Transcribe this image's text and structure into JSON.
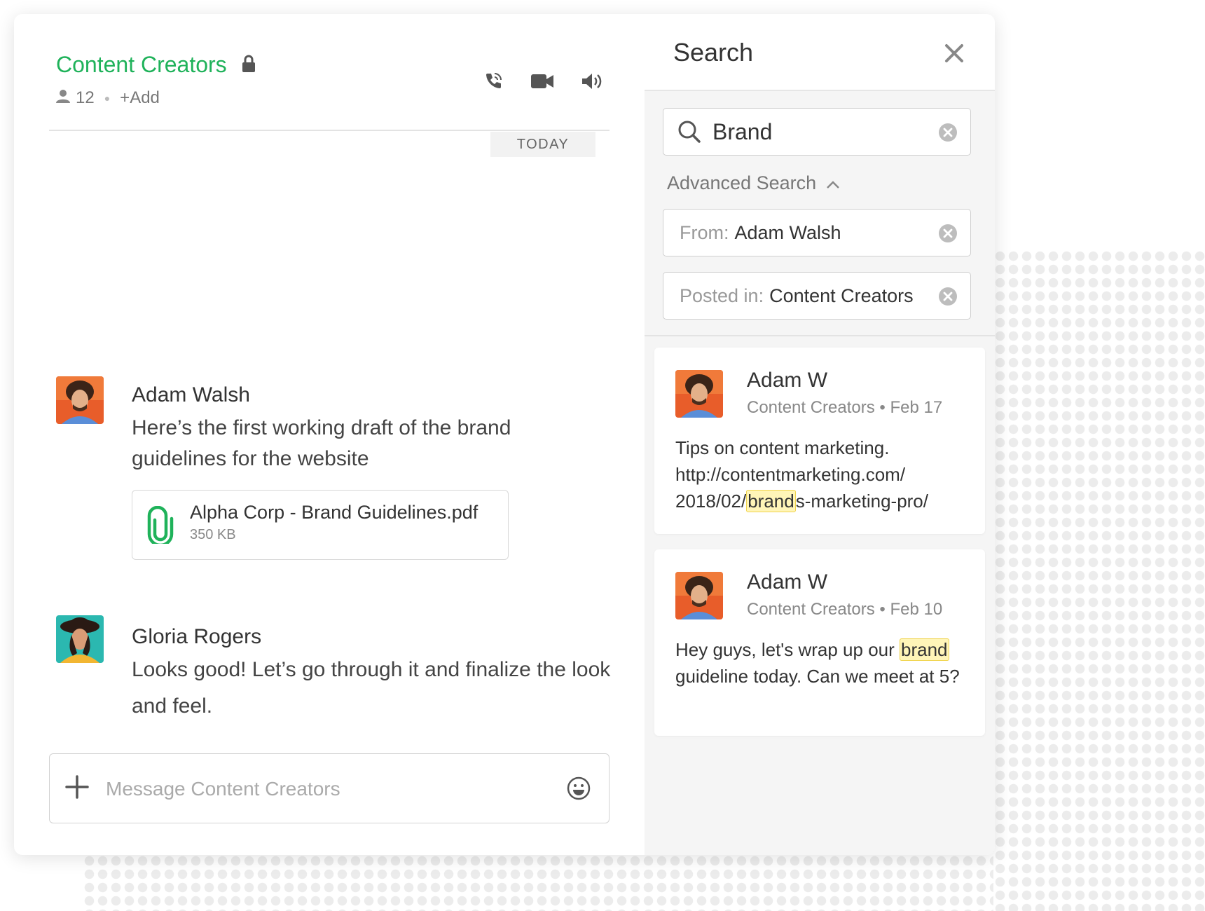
{
  "channel": {
    "title": "Content Creators",
    "member_count": "12",
    "add_label": "+Add",
    "today_label": "TODAY"
  },
  "messages": [
    {
      "author": "Adam Walsh",
      "text": "Here’s the first working draft of the brand guidelines for the website",
      "attachment": {
        "name": "Alpha Corp - Brand Guidelines.pdf",
        "size": "350 KB"
      }
    },
    {
      "author": "Gloria Rogers",
      "text": "Looks good! Let’s go through it and finalize the look and feel."
    }
  ],
  "composer": {
    "placeholder": "Message Content Creators"
  },
  "search": {
    "title": "Search",
    "query": "Brand",
    "advanced_label": "Advanced Search",
    "filters": {
      "from_label": "From:",
      "from_value": "Adam Walsh",
      "posted_label": "Posted in:",
      "posted_value": "Content Creators"
    },
    "results": [
      {
        "author": "Adam W",
        "channel": "Content Creators",
        "date": "Feb 17",
        "text_before": "Tips on content marketing. http://contentmarketing.com/ 2018/02/",
        "text_highlight": "brand",
        "text_after": "s-marketing-pro/"
      },
      {
        "author": "Adam W",
        "channel": "Content Creators",
        "date": "Feb 10",
        "text_before": "Hey guys, let's wrap up our ",
        "text_highlight": "brand",
        "text_after": " guideline today. Can we meet at 5?"
      }
    ]
  },
  "colors": {
    "accent": "#1fb25a",
    "highlight": "#fff5b8",
    "pane_bg": "#f5f5f5"
  },
  "icons": [
    "lock-icon",
    "user-icon",
    "phone-icon",
    "video-icon",
    "speaker-icon",
    "paperclip-icon",
    "plus-icon",
    "emoji-icon",
    "search-icon",
    "close-icon",
    "clear-icon",
    "chevron-up-icon"
  ]
}
